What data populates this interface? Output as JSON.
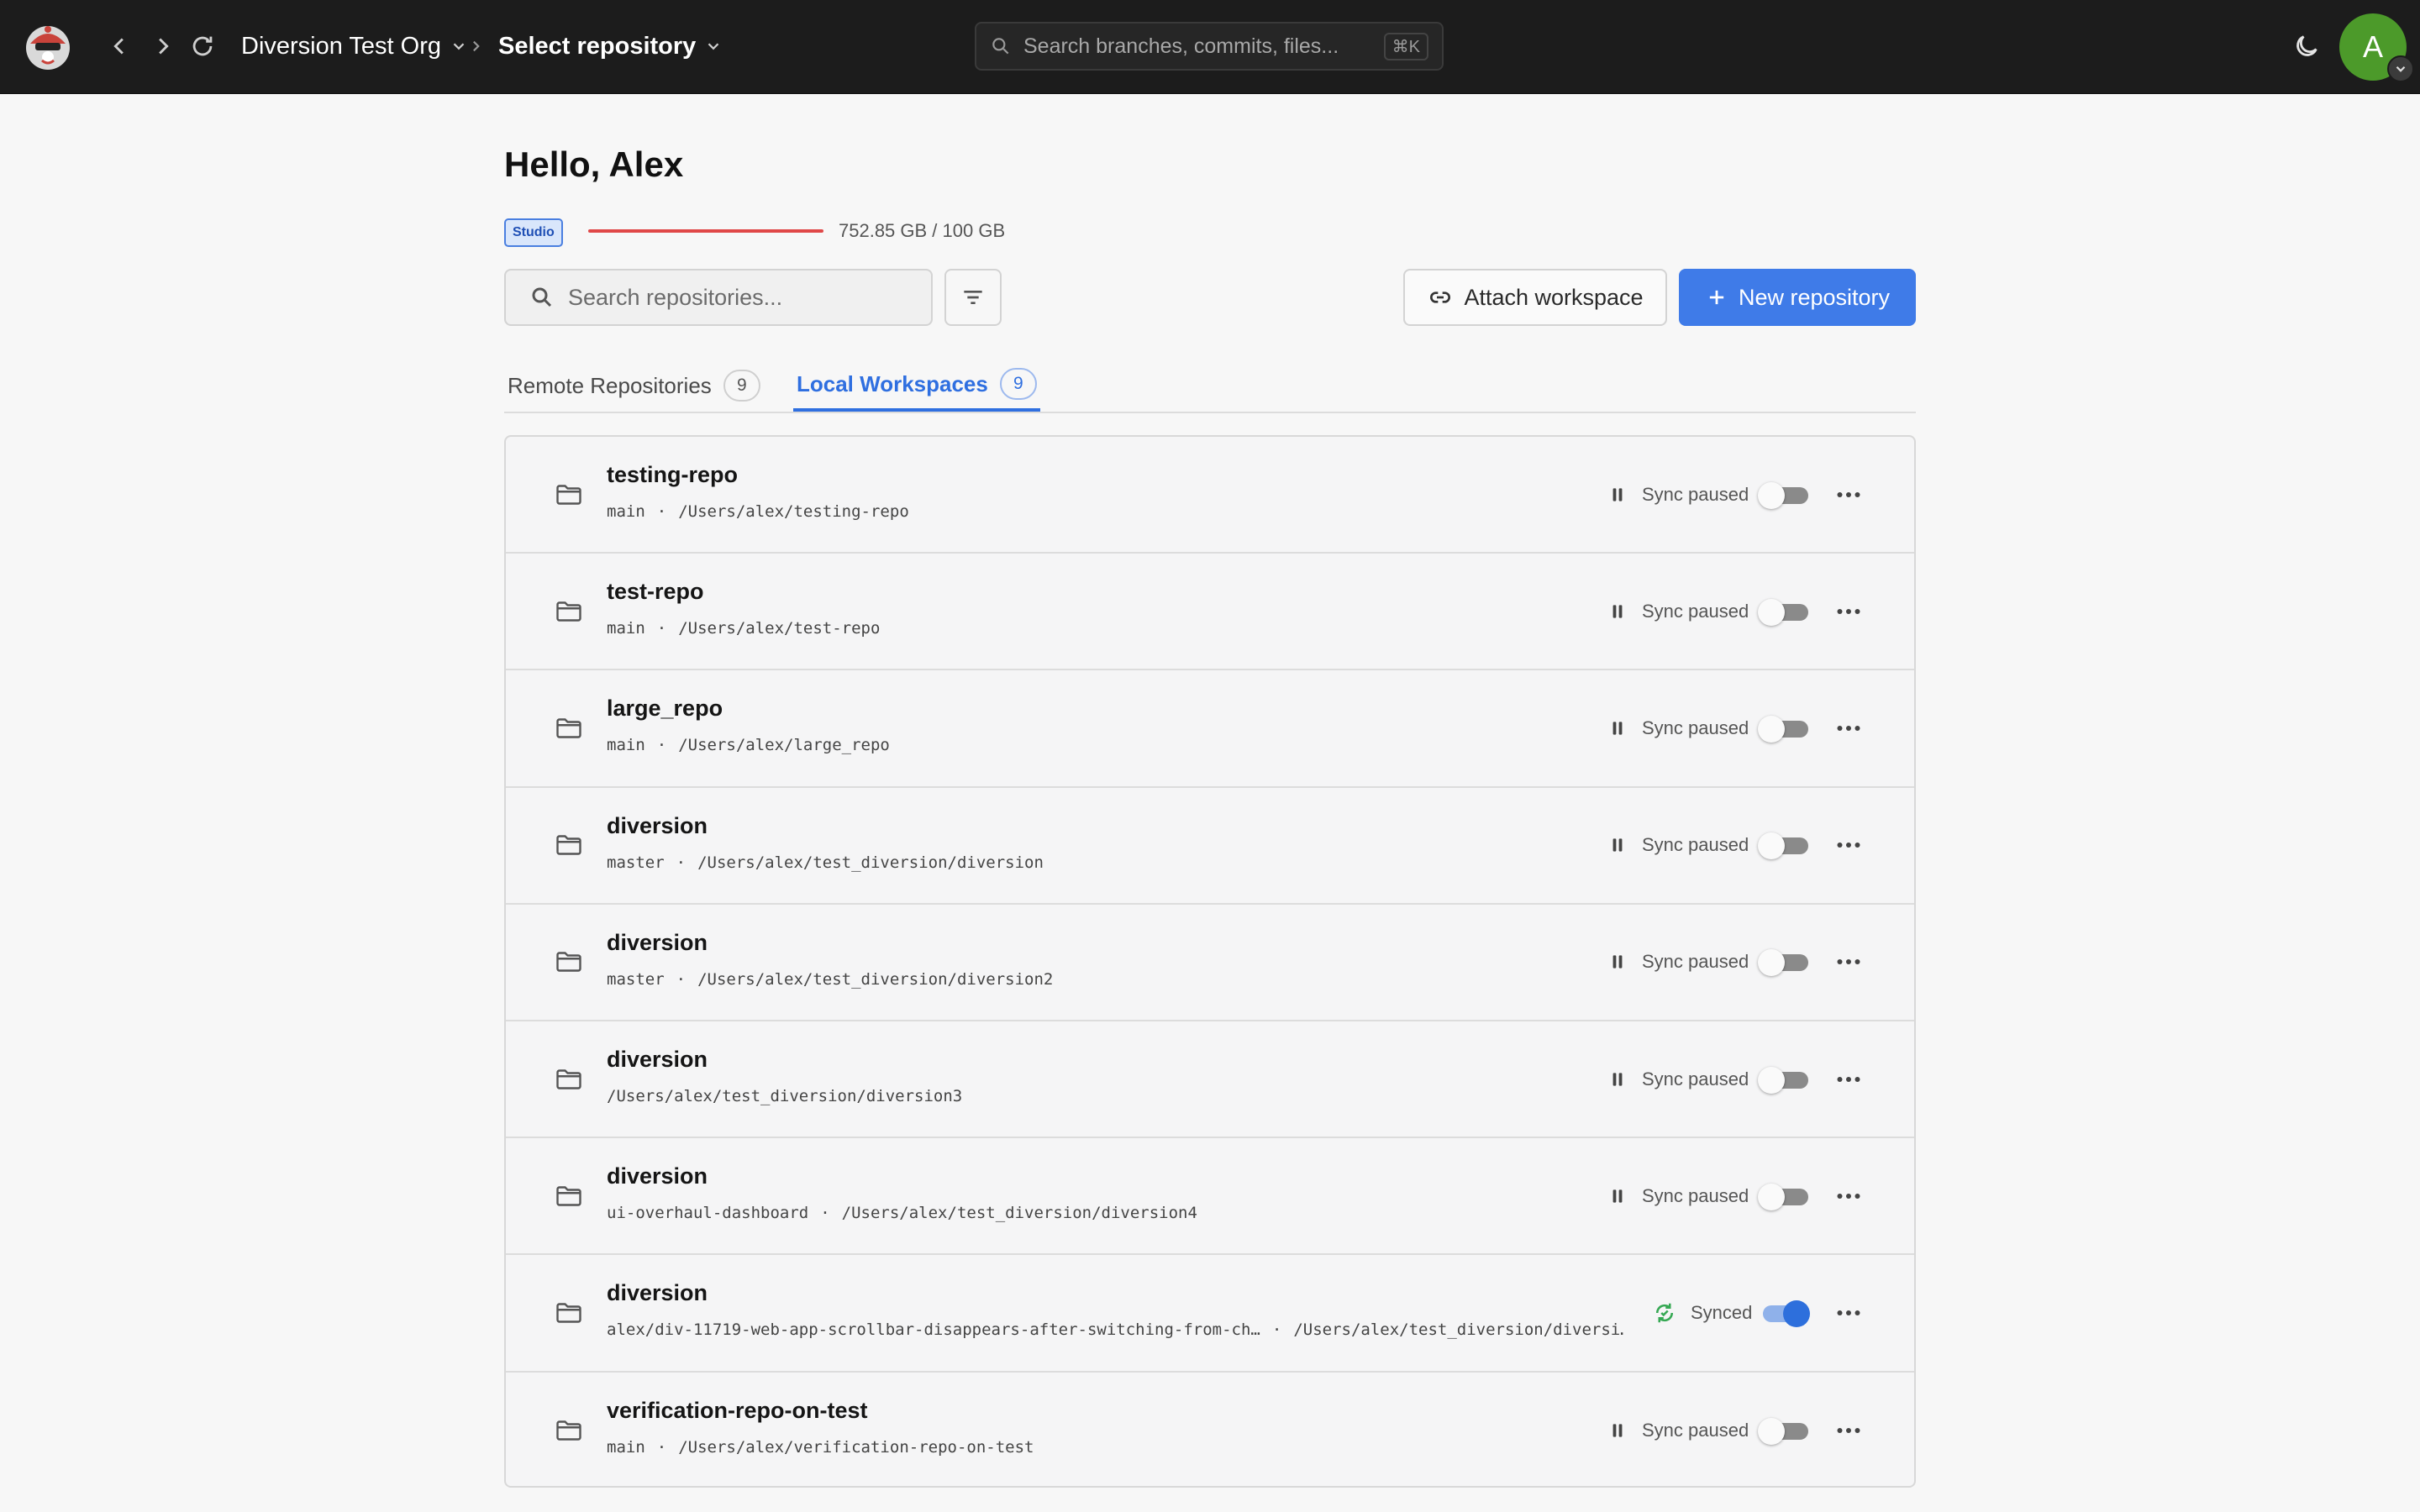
{
  "topbar": {
    "org_name": "Diversion Test Org",
    "repo_select": "Select repository",
    "search_placeholder": "Search branches, commits, files...",
    "search_shortcut": "⌘K",
    "avatar_initial": "A"
  },
  "greeting": "Hello, Alex",
  "plan": {
    "badge": "Studio",
    "usage": "752.85 GB / 100 GB",
    "bar_color": "#e04848"
  },
  "toolbar": {
    "search_placeholder": "Search repositories...",
    "attach_label": "Attach workspace",
    "new_label": "New repository"
  },
  "tabs": [
    {
      "label": "Remote Repositories",
      "count": "9"
    },
    {
      "label": "Local Workspaces",
      "count": "9"
    }
  ],
  "workspaces": [
    {
      "name": "testing-repo",
      "branch": "main",
      "sep": "·",
      "path": "/Users/alex/testing-repo",
      "status": "Sync paused",
      "synced": false
    },
    {
      "name": "test-repo",
      "branch": "main",
      "sep": "·",
      "path": "/Users/alex/test-repo",
      "status": "Sync paused",
      "synced": false
    },
    {
      "name": "large_repo",
      "branch": "main",
      "sep": "·",
      "path": "/Users/alex/large_repo",
      "status": "Sync paused",
      "synced": false
    },
    {
      "name": "diversion",
      "branch": "master",
      "sep": "·",
      "path": "/Users/alex/test_diversion/diversion",
      "status": "Sync paused",
      "synced": false
    },
    {
      "name": "diversion",
      "branch": "master",
      "sep": "·",
      "path": "/Users/alex/test_diversion/diversion2",
      "status": "Sync paused",
      "synced": false
    },
    {
      "name": "diversion",
      "branch": "",
      "sep": "",
      "path": "/Users/alex/test_diversion/diversion3",
      "status": "Sync paused",
      "synced": false
    },
    {
      "name": "diversion",
      "branch": "ui-overhaul-dashboard",
      "sep": "·",
      "path": "/Users/alex/test_diversion/diversion4",
      "status": "Sync paused",
      "synced": false
    },
    {
      "name": "diversion",
      "branch": "alex/div-11719-web-app-scrollbar-disappears-after-switching-from-ch…",
      "sep": "·",
      "path": "/Users/alex/test_diversion/diversi…",
      "status": "Synced",
      "synced": true
    },
    {
      "name": "verification-repo-on-test",
      "branch": "main",
      "sep": "·",
      "path": "/Users/alex/verification-repo-on-test",
      "status": "Sync paused",
      "synced": false
    }
  ],
  "colors": {
    "accent": "#3f7be8",
    "synced": "#35a853",
    "topbar": "#1c1c1c"
  }
}
